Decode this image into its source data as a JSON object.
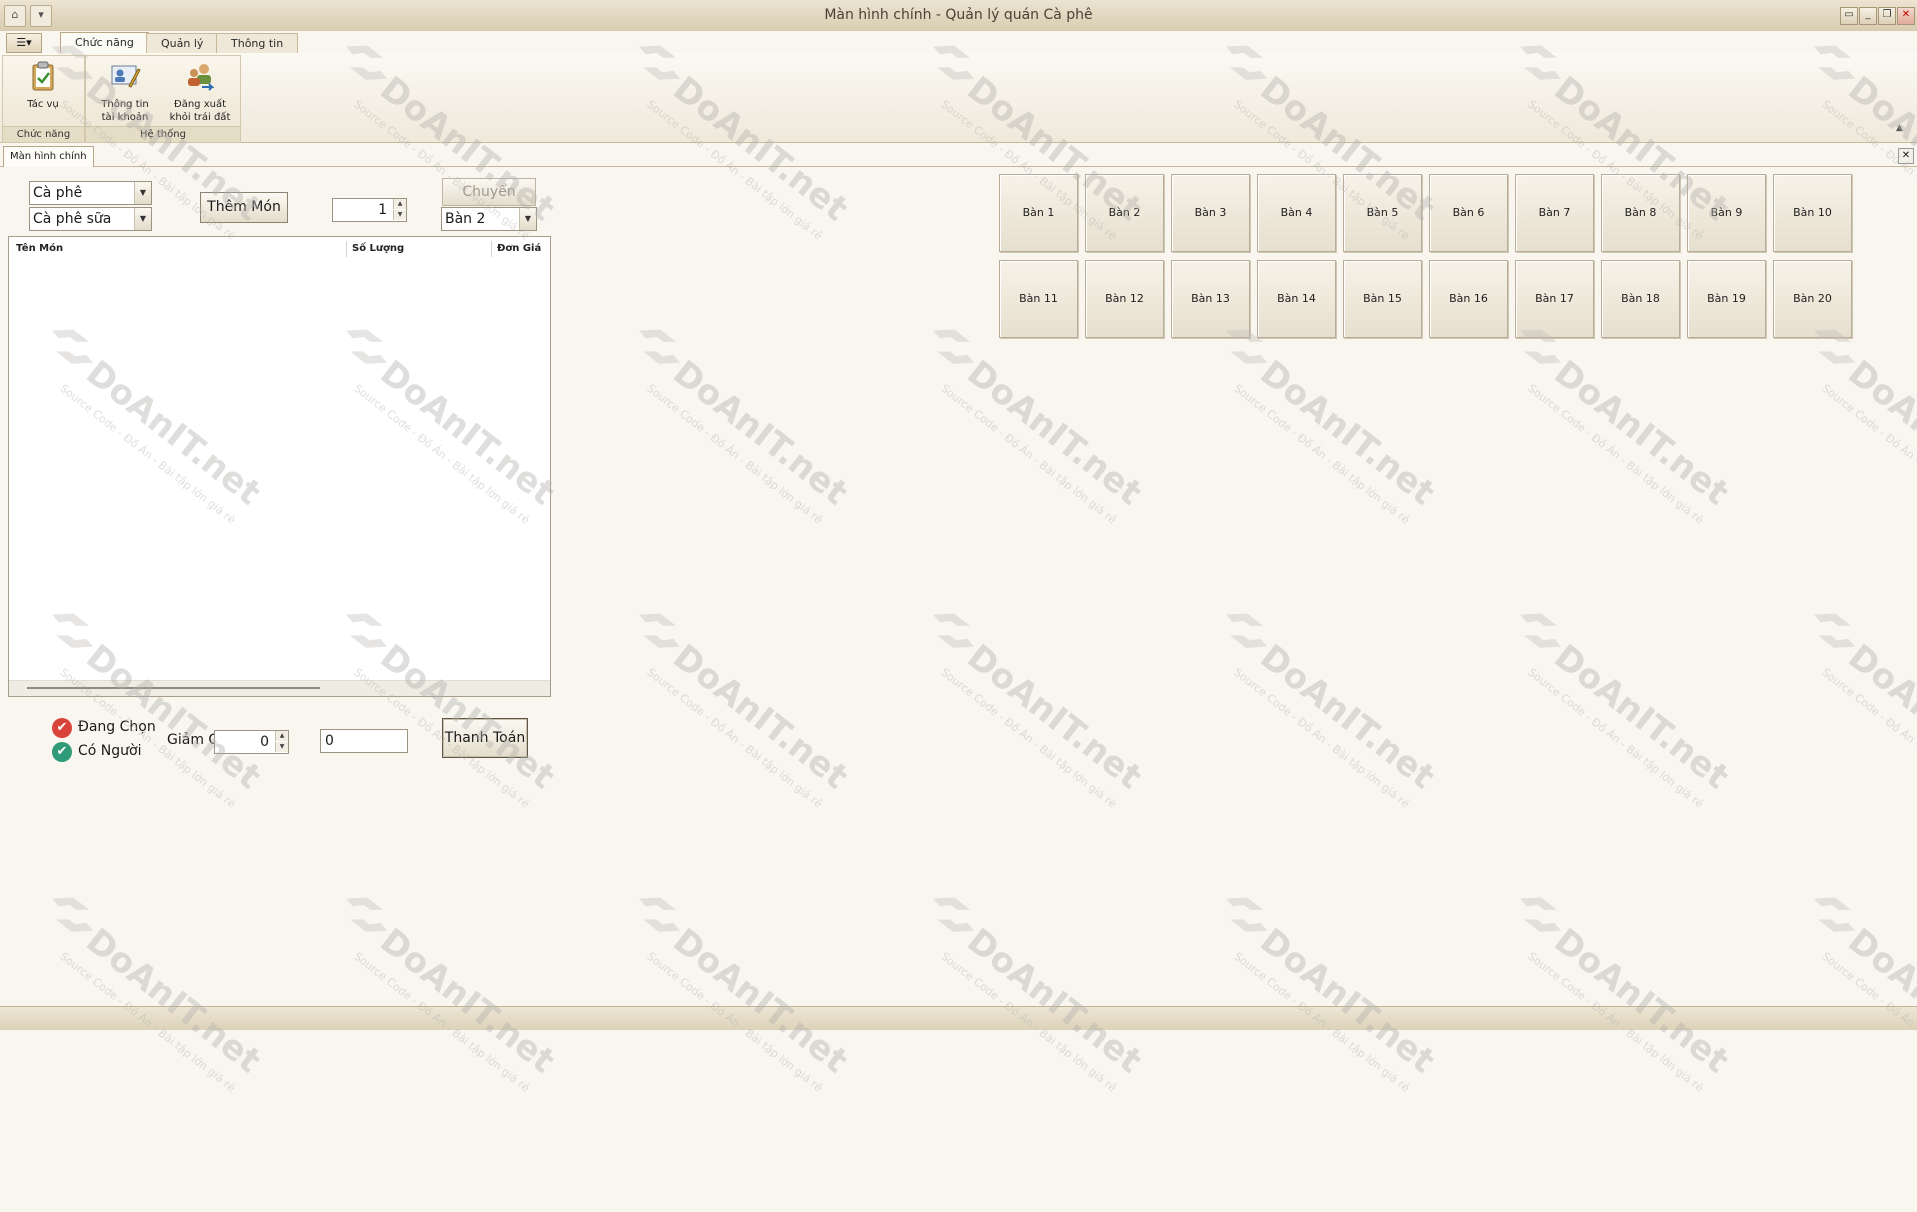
{
  "window": {
    "title": "Màn hình chính - Quản lý quán Cà phê"
  },
  "ribbon": {
    "tabs": [
      "Chức năng",
      "Quản lý",
      "Thông tin"
    ],
    "active_tab": "Chức năng",
    "groups": [
      {
        "label": "Chức năng",
        "buttons": [
          {
            "line1": "Tác vụ",
            "line2": ""
          }
        ]
      },
      {
        "label": "Hệ thống",
        "buttons": [
          {
            "line1": "Thông tin",
            "line2": "tài khoản"
          },
          {
            "line1": "Đăng xuất",
            "line2": "khỏi trái đất"
          }
        ]
      }
    ]
  },
  "document_tab": "Màn hình chính",
  "order": {
    "category": "Cà phê",
    "item": "Cà phê sữa",
    "add_button": "Thêm Món",
    "quantity": "1",
    "transfer_button": "Chuyển",
    "transfer_target": "Bàn 2",
    "columns": [
      "Tên Món",
      "Số Lượng",
      "Đơn Giá"
    ]
  },
  "legend": {
    "selected": "Đang Chọn",
    "occupied": "Có Người"
  },
  "checkout": {
    "discount_label": "Giảm Giá",
    "discount_value": "0",
    "total": "0",
    "pay_button": "Thanh Toán"
  },
  "tables": [
    "Bàn 1",
    "Bàn 2",
    "Bàn 3",
    "Bàn 4",
    "Bàn 5",
    "Bàn 6",
    "Bàn 7",
    "Bàn 8",
    "Bàn 9",
    "Bàn 10",
    "Bàn 11",
    "Bàn 12",
    "Bàn 13",
    "Bàn 14",
    "Bàn 15",
    "Bàn 16",
    "Bàn 17",
    "Bàn 18",
    "Bàn 19",
    "Bàn 20"
  ],
  "watermark": {
    "brand": "DoAnIT.net",
    "tagline": "Source Code - Đồ Án - Bài tập lớn giá rẻ"
  },
  "colors": {
    "selected": "#d9443a",
    "occupied": "#2f9a77"
  }
}
